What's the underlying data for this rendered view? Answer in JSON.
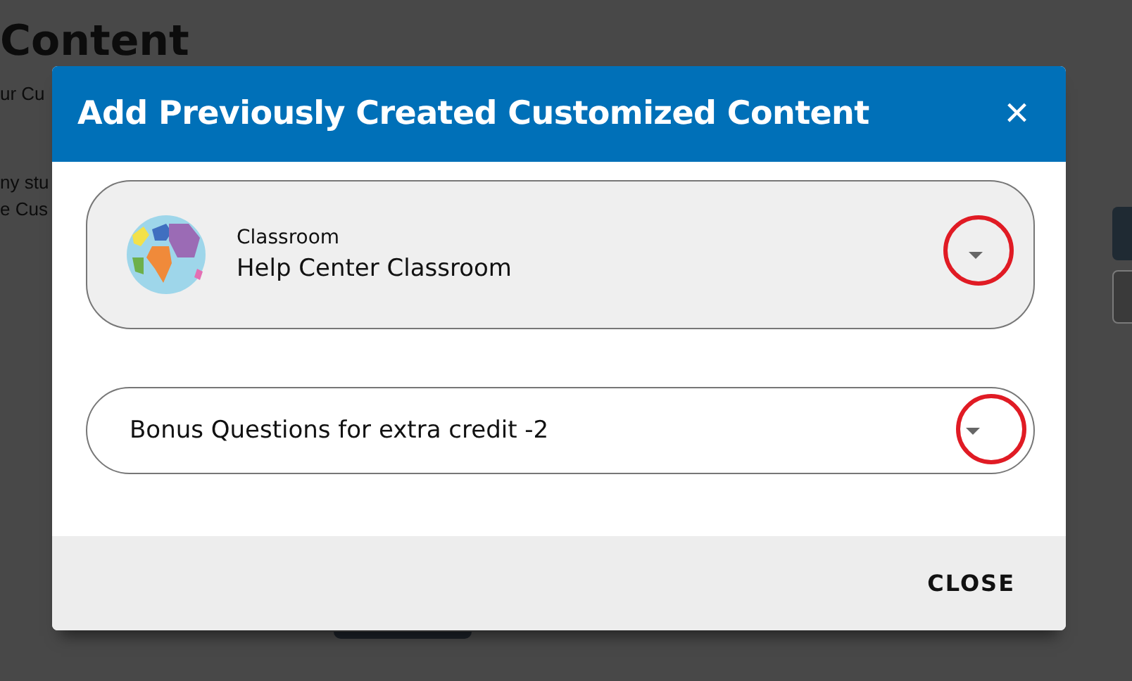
{
  "background_page": {
    "heading": "Content",
    "texts": [
      "ur Cu",
      "ny stu",
      "e Cus"
    ]
  },
  "dialog": {
    "title": "Add Previously Created Customized Content",
    "close_icon": "×",
    "selects": [
      {
        "kind": "classroom",
        "label": "Classroom",
        "value": "Help Center Classroom",
        "highlighted": true
      },
      {
        "kind": "plain",
        "value": "Bonus Questions for extra credit -2",
        "highlighted": true
      }
    ],
    "footer_button": "CLOSE"
  }
}
